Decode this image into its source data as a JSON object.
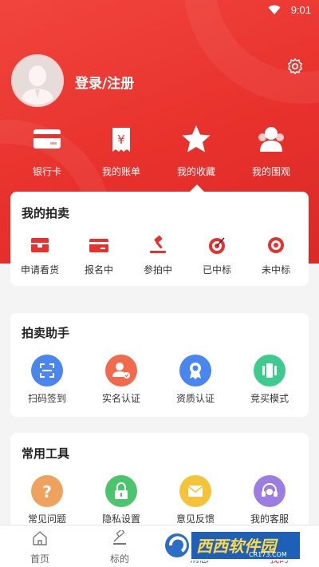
{
  "status_bar": {
    "time": "9:01"
  },
  "profile": {
    "login_label": "登录/注册"
  },
  "quick_actions": [
    {
      "label": "银行卡",
      "icon": "bank-card-icon"
    },
    {
      "label": "我的账单",
      "icon": "bill-icon"
    },
    {
      "label": "我的收藏",
      "icon": "star-icon"
    },
    {
      "label": "我的围观",
      "icon": "watchers-icon"
    }
  ],
  "my_auction": {
    "title": "我的拍卖",
    "items": [
      {
        "label": "申请看货",
        "icon": "box-icon"
      },
      {
        "label": "报名中",
        "icon": "card-icon"
      },
      {
        "label": "参拍中",
        "icon": "gavel-icon"
      },
      {
        "label": "已中标",
        "icon": "target-hit-icon"
      },
      {
        "label": "未中标",
        "icon": "target-icon"
      }
    ]
  },
  "assistant": {
    "title": "拍卖助手",
    "items": [
      {
        "label": "扫码签到",
        "icon": "scan-icon",
        "color": "#4a86ef"
      },
      {
        "label": "实名认证",
        "icon": "id-verify-icon",
        "color": "#f26a4b"
      },
      {
        "label": "资质认证",
        "icon": "certificate-icon",
        "color": "#4a86ef"
      },
      {
        "label": "竞买模式",
        "icon": "bidding-mode-icon",
        "color": "#3ecb8d"
      }
    ]
  },
  "tools": {
    "title": "常用工具",
    "items": [
      {
        "label": "常见问题",
        "icon": "question-icon",
        "color": "#eea25e"
      },
      {
        "label": "隐私设置",
        "icon": "lock-icon",
        "color": "#4cc36d"
      },
      {
        "label": "意见反馈",
        "icon": "feedback-icon",
        "color": "#f5c33a"
      },
      {
        "label": "我的客服",
        "icon": "headset-icon",
        "color": "#9b7ee0"
      }
    ]
  },
  "tab_bar": [
    {
      "label": "首页",
      "icon": "home-icon"
    },
    {
      "label": "标的",
      "icon": "gavel-tab-icon"
    },
    {
      "label": "消息",
      "icon": "message-icon"
    },
    {
      "label": "我的",
      "icon": "profile-icon"
    }
  ],
  "watermark": {
    "text": "西西软件园",
    "subtext": "CR173.COM"
  },
  "colors": {
    "brand_red": "#e8312c",
    "tab_active": "#e8312c"
  }
}
